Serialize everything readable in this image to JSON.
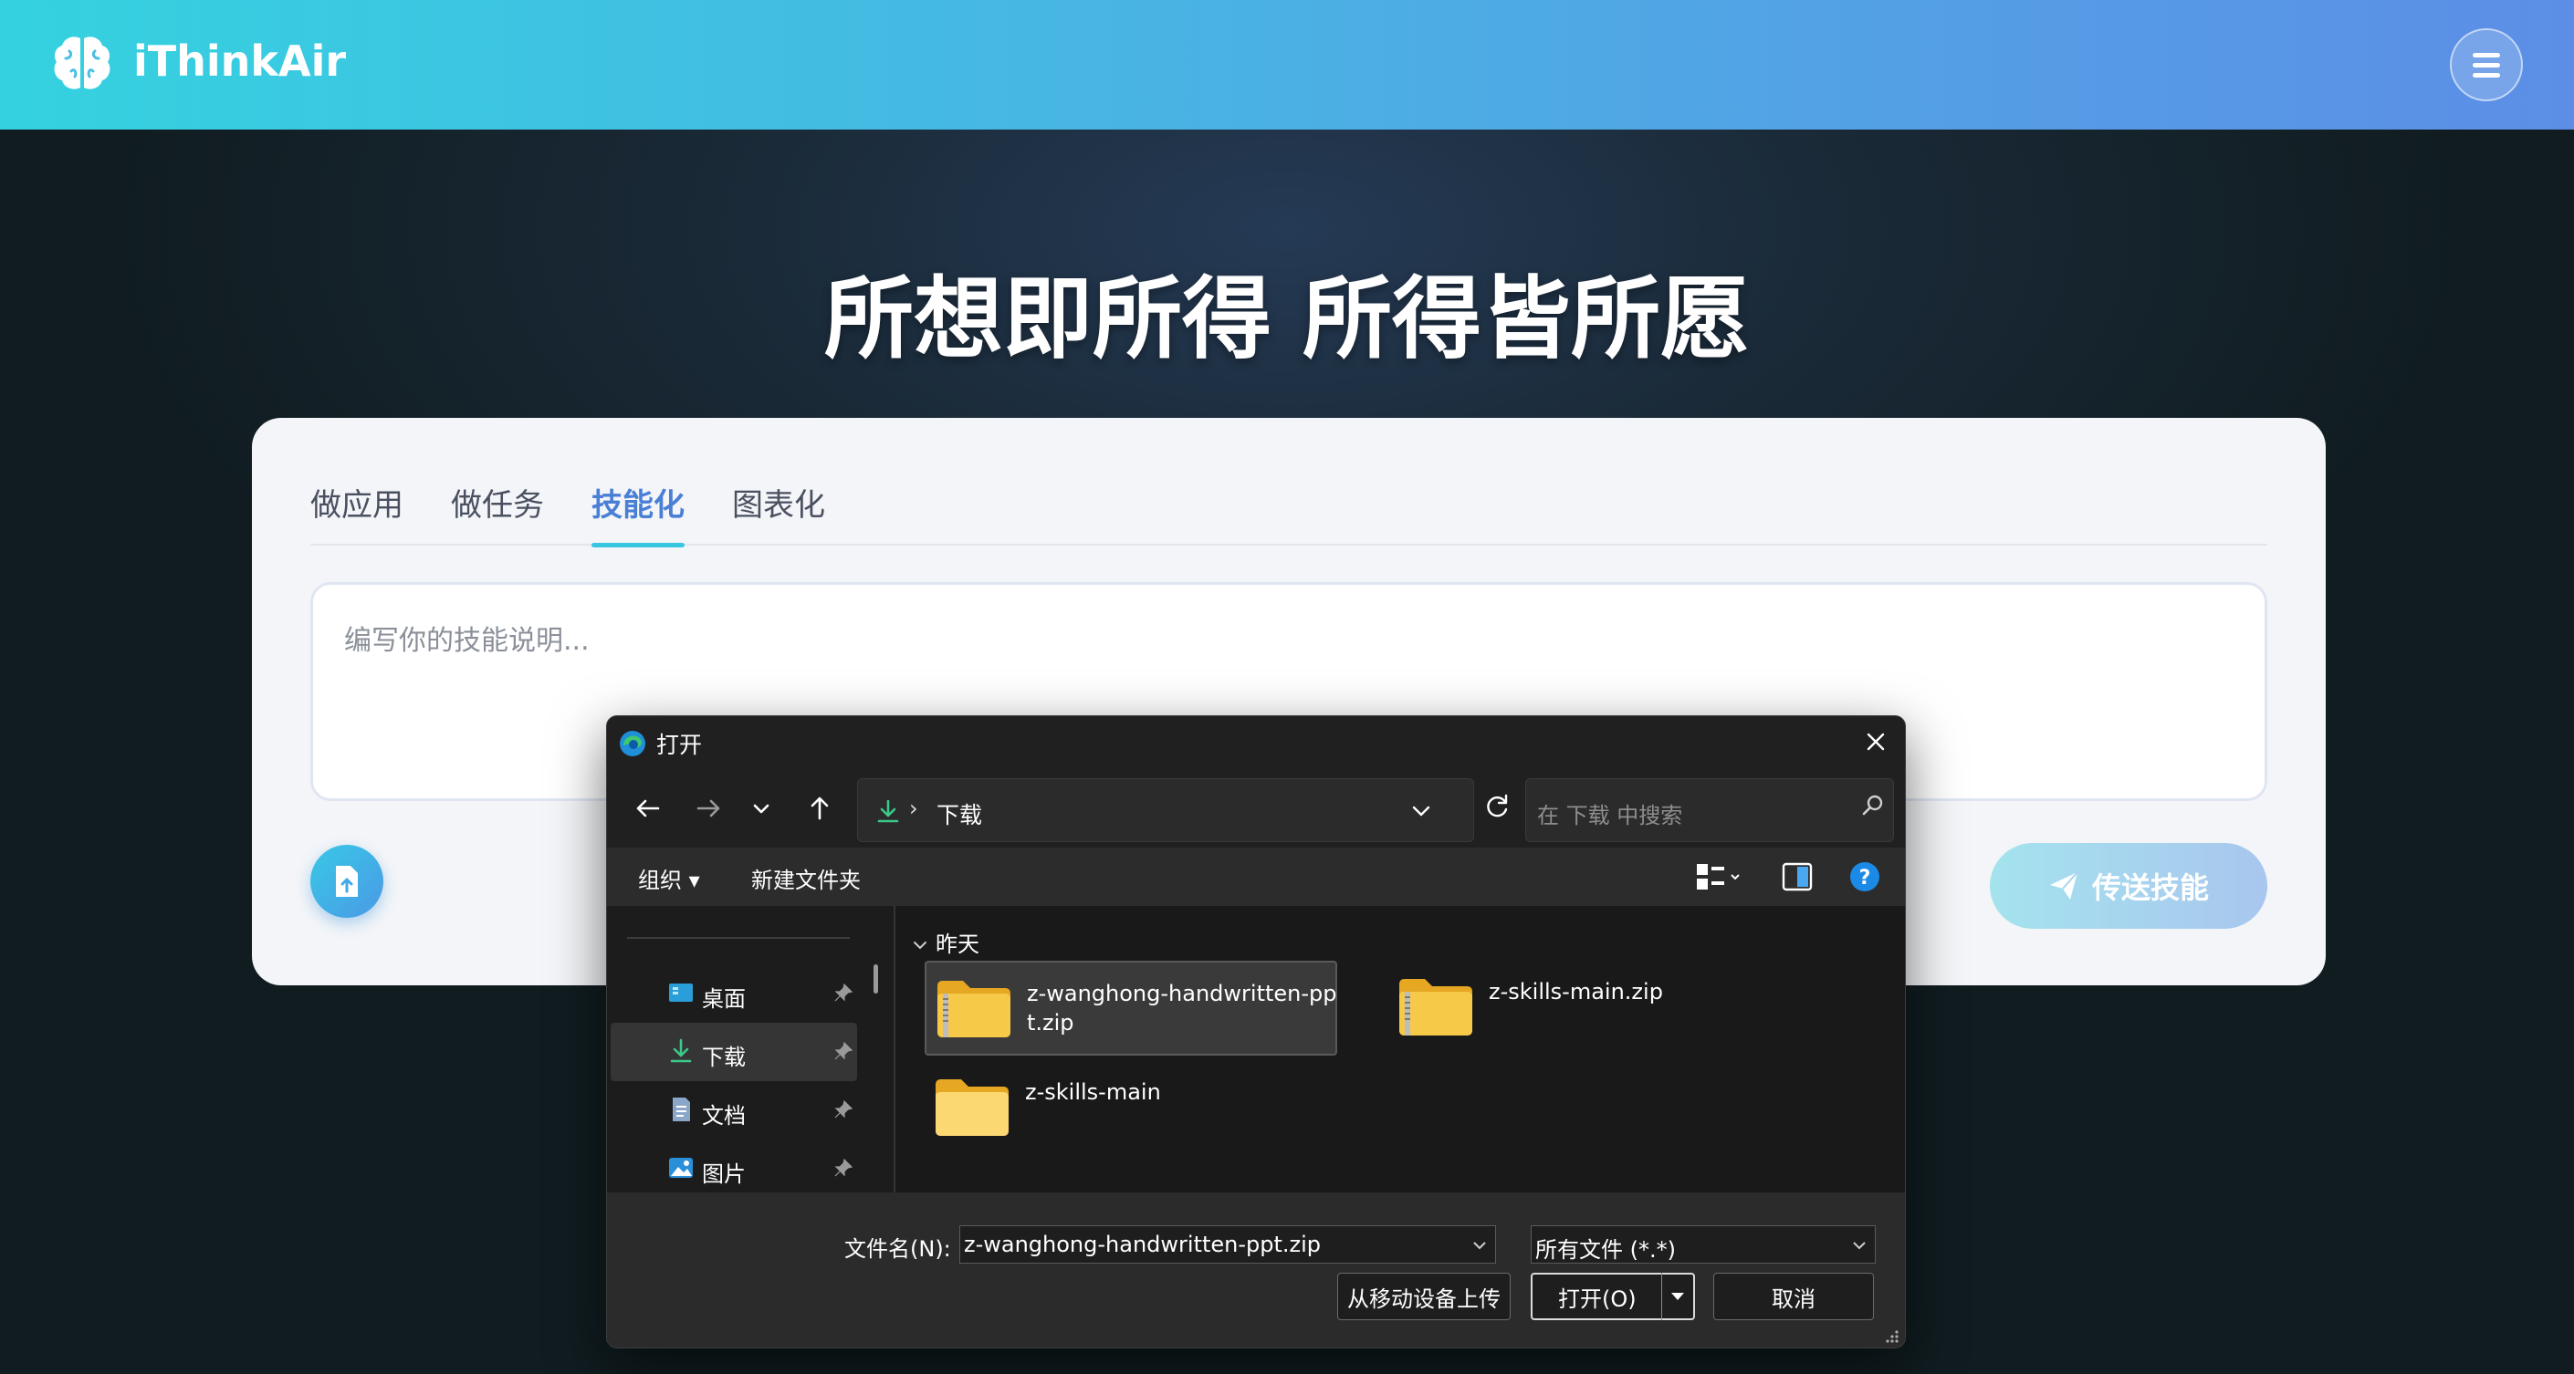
{
  "header": {
    "brand": "iThinkAir",
    "logo_icon": "brain-icon",
    "menu_icon": "hamburger-menu-icon"
  },
  "hero": {
    "title": "所想即所得 所得皆所愿"
  },
  "card": {
    "tabs": [
      {
        "label": "做应用",
        "active": false
      },
      {
        "label": "做任务",
        "active": false
      },
      {
        "label": "技能化",
        "active": true
      },
      {
        "label": "图表化",
        "active": false
      }
    ],
    "textarea_placeholder": "编写你的技能说明...",
    "upload_icon": "file-upload-icon",
    "send_label": "传送技能",
    "send_icon": "paper-plane-icon"
  },
  "dialog": {
    "title": "打开",
    "app_icon": "edge-browser-icon",
    "address": {
      "separator": "›",
      "location": "下载"
    },
    "search_placeholder": "在 下载 中搜索",
    "commands": {
      "organize": "组织 ▾",
      "new_folder": "新建文件夹"
    },
    "sidebar": [
      {
        "label": "桌面",
        "icon": "desktop-icon",
        "pinned": true,
        "selected": false
      },
      {
        "label": "下载",
        "icon": "download-icon",
        "pinned": true,
        "selected": true
      },
      {
        "label": "文档",
        "icon": "document-icon",
        "pinned": true,
        "selected": false
      },
      {
        "label": "图片",
        "icon": "pictures-icon",
        "pinned": true,
        "selected": false
      }
    ],
    "group": "昨天",
    "files": [
      {
        "name": "z-wanghong-handwritten-ppt.zip",
        "type": "zip",
        "selected": true
      },
      {
        "name": "z-skills-main.zip",
        "type": "zip",
        "selected": false
      },
      {
        "name": "z-skills-main",
        "type": "folder",
        "selected": false
      }
    ],
    "footer": {
      "filename_label": "文件名(N):",
      "filename_value": "z-wanghong-handwritten-ppt.zip",
      "filetype_value": "所有文件 (*.*)",
      "upload_mobile": "从移动设备上传",
      "open": "打开(O)",
      "cancel": "取消"
    }
  },
  "colors": {
    "header_start": "#34d2e0",
    "header_end": "#5c8ee6",
    "tab_active": "#4a7fd6",
    "tab_indicator": "#38c6e0",
    "folder_yellow": "#f5c542"
  }
}
